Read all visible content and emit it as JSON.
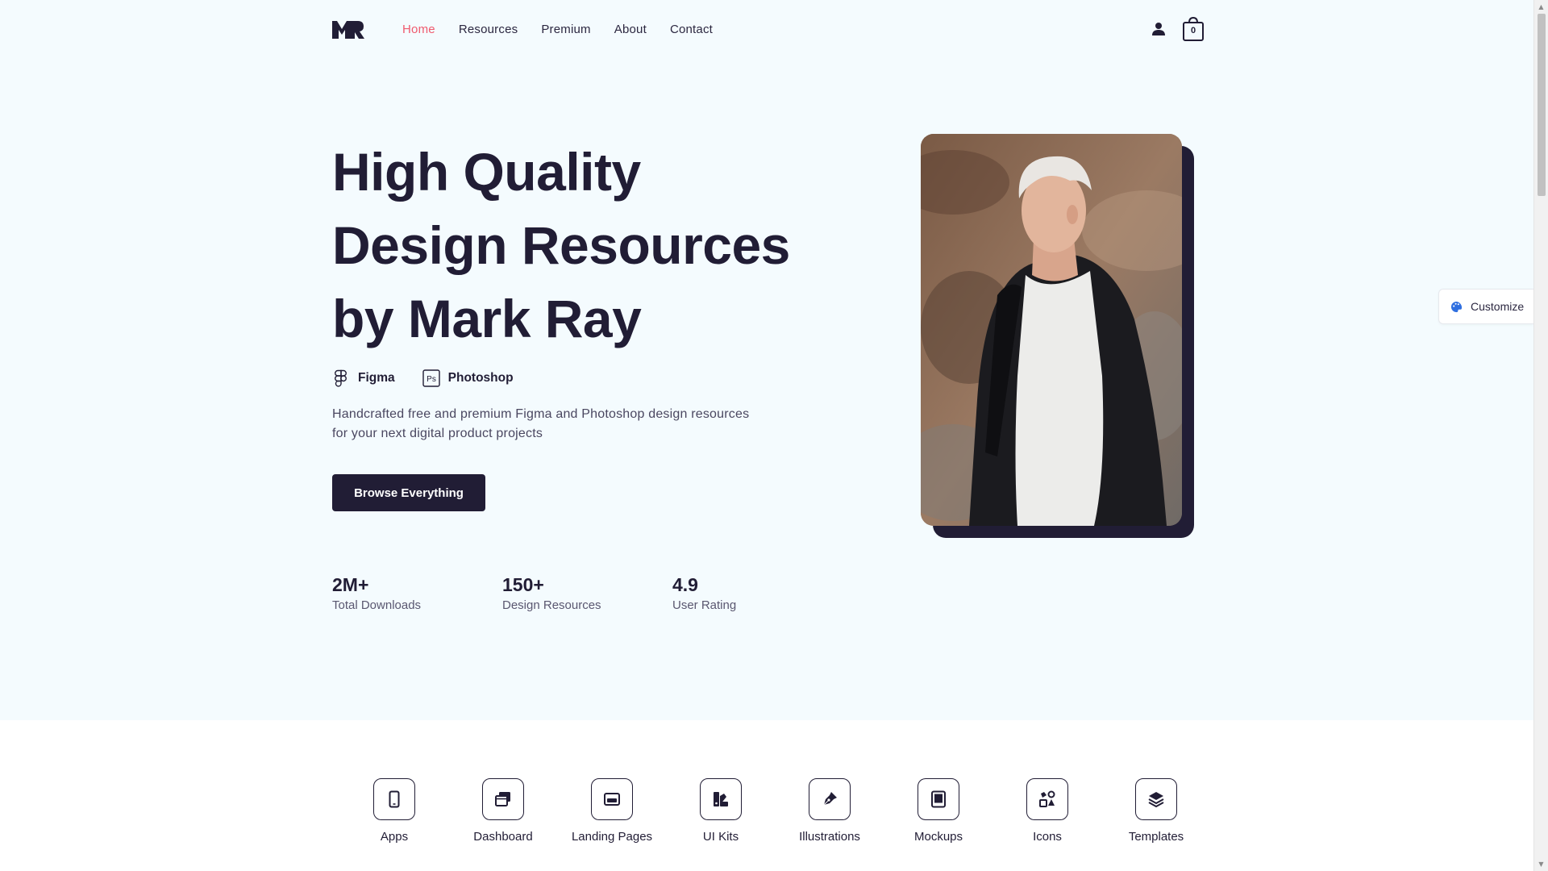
{
  "colors": {
    "primary": "#211d35",
    "accent": "#ef5b6f",
    "hero_background": "#f4fbfe",
    "customize_icon": "#2f6fe0"
  },
  "header": {
    "logo_icon": "mr-logo",
    "nav": [
      {
        "label": "Home",
        "active": true
      },
      {
        "label": "Resources",
        "active": false
      },
      {
        "label": "Premium",
        "active": false
      },
      {
        "label": "About",
        "active": false
      },
      {
        "label": "Contact",
        "active": false
      }
    ],
    "account_icon": "user-icon",
    "cart": {
      "icon": "shopping-bag-icon",
      "count": "0"
    }
  },
  "hero": {
    "title_lines": [
      "High Quality",
      "Design Resources",
      "by Mark Ray"
    ],
    "tools": [
      {
        "icon": "figma-icon",
        "label": "Figma"
      },
      {
        "icon": "photoshop-icon",
        "label": "Photoshop"
      }
    ],
    "description": "Handcrafted free and premium Figma and Photoshop design resources for your next digital product projects",
    "cta_label": "Browse Everything",
    "stats": [
      {
        "value": "2M+",
        "label": "Total Downloads"
      },
      {
        "value": "150+",
        "label": "Design Resources"
      },
      {
        "value": "4.9",
        "label": "User Rating"
      }
    ]
  },
  "customize": {
    "icon": "palette-icon",
    "label": "Customize"
  },
  "categories": [
    {
      "icon": "phone-icon",
      "label": "Apps"
    },
    {
      "icon": "windows-icon",
      "label": "Dashboard"
    },
    {
      "icon": "card-icon",
      "label": "Landing Pages"
    },
    {
      "icon": "swatches-icon",
      "label": "UI Kits"
    },
    {
      "icon": "pen-nib-icon",
      "label": "Illustrations"
    },
    {
      "icon": "tablet-icon",
      "label": "Mockups"
    },
    {
      "icon": "shapes-icon",
      "label": "Icons"
    },
    {
      "icon": "layers-icon",
      "label": "Templates"
    }
  ]
}
